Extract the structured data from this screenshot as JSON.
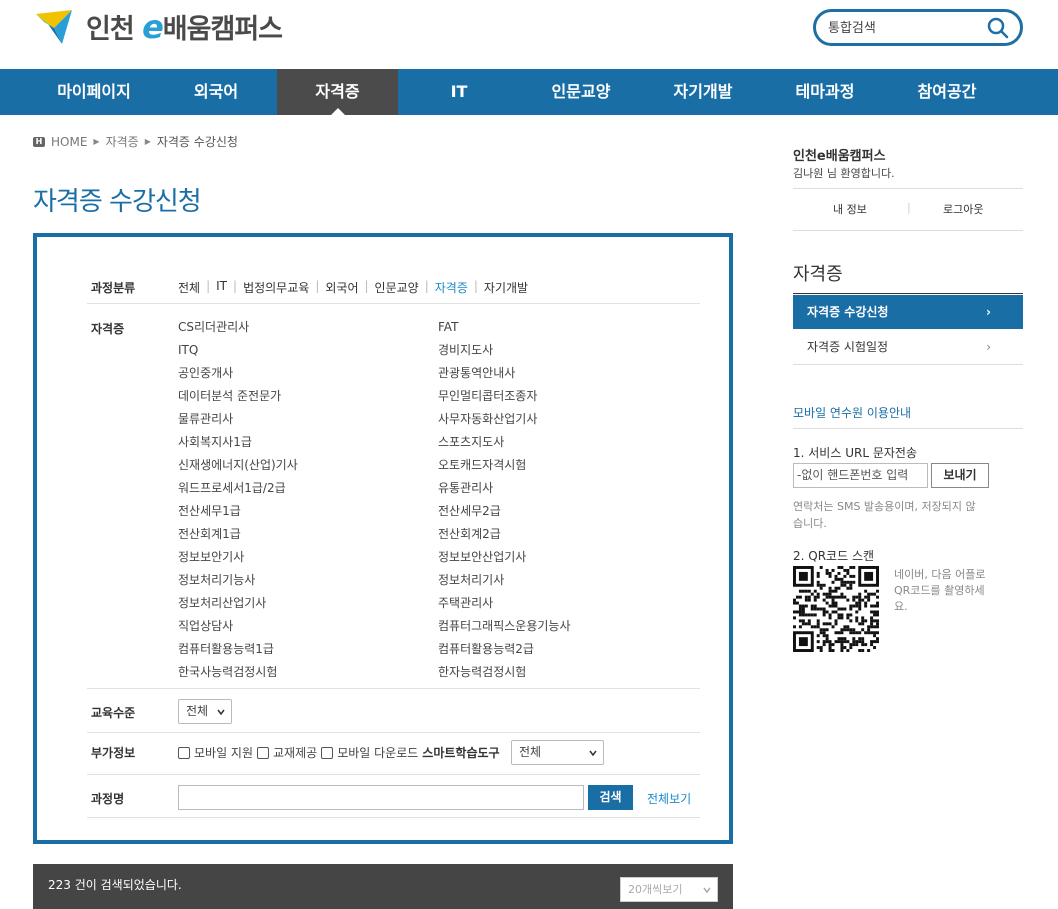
{
  "header": {
    "logo_text_1": "인천",
    "logo_e": "e",
    "logo_text_2": "배움캠퍼스",
    "search_placeholder": "통합검색",
    "brand_color": "#1a6ea6"
  },
  "nav": {
    "items": [
      "마이페이지",
      "외국어",
      "자격증",
      "IT",
      "인문교양",
      "자기개발",
      "테마과정",
      "참여공간"
    ],
    "active_index": 2
  },
  "breadcrumb": {
    "home": "HOME",
    "level1": "자격증",
    "current": "자격증 수강신청"
  },
  "page_title": "자격증 수강신청",
  "filter": {
    "category_label": "과정분류",
    "categories": [
      "전체",
      "IT",
      "법정의무교육",
      "외국어",
      "인문교양",
      "자격증",
      "자기개발"
    ],
    "active_category": "자격증",
    "cert_label": "자격증",
    "certs_left": [
      "CS리더관리사",
      "ITQ",
      "공인중개사",
      "데이터분석 준전문가",
      "물류관리사",
      "사회복지사1급",
      "신재생에너지(산업)기사",
      "워드프로세서1급/2급",
      "전산세무1급",
      "전산회계1급",
      "정보보안기사",
      "정보처리기능사",
      "정보처리산업기사",
      "직업상담사",
      "컴퓨터활용능력1급",
      "한국사능력검정시험"
    ],
    "certs_right": [
      "FAT",
      "경비지도사",
      "관광통역안내사",
      "무인멀티콥터조종자",
      "사무자동화산업기사",
      "스포츠지도사",
      "오토캐드자격시험",
      "유통관리사",
      "전산세무2급",
      "전산회계2급",
      "정보보안산업기사",
      "정보처리기사",
      "주택관리사",
      "컴퓨터그래픽스운용기능사",
      "컴퓨터활용능력2급",
      "한자능력검정시험"
    ],
    "level_label": "교육수준",
    "level_value": "전체",
    "extra_label": "부가정보",
    "checkbox_1": "모바일 지원",
    "checkbox_2": "교재제공",
    "checkbox_3": "모바일 다운로드",
    "smart_label": "스마트학습도구",
    "smart_value": "전체",
    "course_label": "과정명",
    "course_value": "",
    "search_button": "검색",
    "view_all": "전체보기"
  },
  "results": {
    "count_text": "223 건이 검색되었습니다.",
    "per_page": "20개씩보기"
  },
  "sidebar": {
    "site_name": "인천e배움캠퍼스",
    "welcome": "김나원 님 환영합니다.",
    "my_info": "내 정보",
    "logout": "로그아웃",
    "section_title": "자격증",
    "menu": [
      "자격증 수강신청",
      "자격증 시험일정"
    ],
    "mobile_title": "모바일 연수원 이용안내",
    "step1": "1. 서비스 URL 문자전송",
    "phone_placeholder": "-없이 핸드폰번호 입력",
    "send_button": "보내기",
    "note": "연락처는 SMS 발송용이며, 저장되지 않습니다.",
    "step2": "2. QR코드 스캔",
    "qr_text": "네이버, 다음 어플로 QR코드를 촬영하세요."
  }
}
